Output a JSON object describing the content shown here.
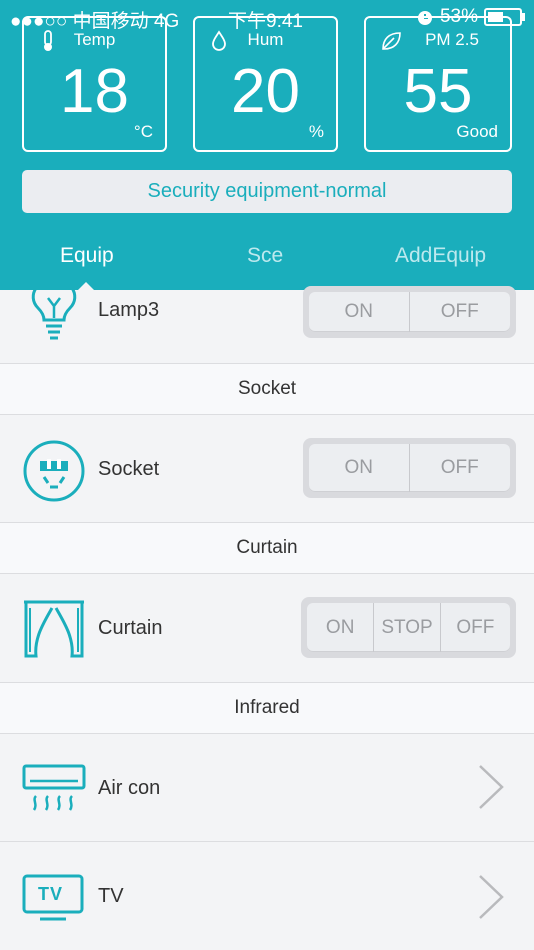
{
  "status_bar": {
    "carrier": "●●●○○ 中国移动  4G",
    "time": "下午9:41",
    "battery_text": "53%"
  },
  "cards": [
    {
      "label": "Temp",
      "value": "18",
      "unit": "°C",
      "icon": "thermometer-icon"
    },
    {
      "label": "Hum",
      "value": "20",
      "unit": "%",
      "icon": "droplet-icon"
    },
    {
      "label": "PM 2.5",
      "value": "55",
      "unit": "Good",
      "icon": "leaf-icon"
    }
  ],
  "security_status": "Security equipment-normal",
  "tabs": [
    {
      "label": "Equip",
      "active": true
    },
    {
      "label": "Sce",
      "active": false
    },
    {
      "label": "AddEquip",
      "active": false
    }
  ],
  "devices": {
    "lamp": {
      "name": "Lamp3",
      "on": "ON",
      "off": "OFF"
    },
    "socket_section": "Socket",
    "socket": {
      "name": "Socket",
      "on": "ON",
      "off": "OFF"
    },
    "curtain_section": "Curtain",
    "curtain": {
      "name": "Curtain",
      "on": "ON",
      "stop": "STOP",
      "off": "OFF"
    },
    "infrared_section": "Infrared",
    "aircon": {
      "name": "Air con"
    },
    "tv": {
      "name": "TV",
      "icon_text": "TV"
    }
  },
  "colors": {
    "accent": "#1aaebc",
    "background": "#eff0f3"
  }
}
